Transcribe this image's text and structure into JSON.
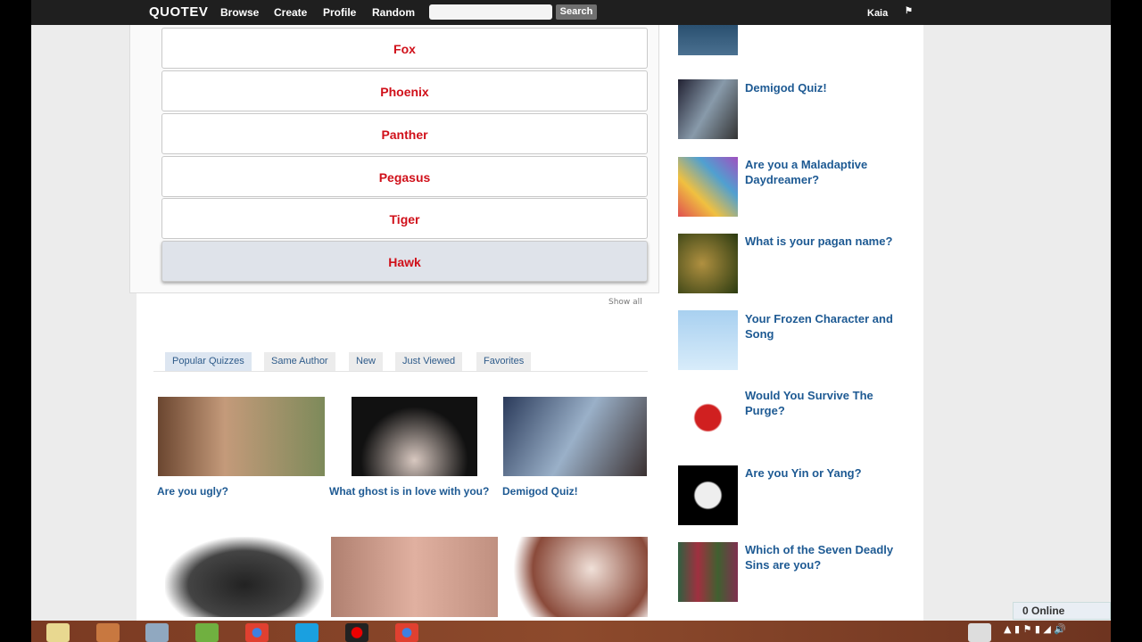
{
  "topbar": {
    "logo": "QUOTEV",
    "nav": [
      "Browse",
      "Create",
      "Profile",
      "Random"
    ],
    "search_placeholder": "",
    "search_button": "Search",
    "user": "Kaia"
  },
  "options": [
    {
      "label": "Fox",
      "selected": false
    },
    {
      "label": "Phoenix",
      "selected": false
    },
    {
      "label": "Panther",
      "selected": false
    },
    {
      "label": "Pegasus",
      "selected": false
    },
    {
      "label": "Tiger",
      "selected": false
    },
    {
      "label": "Hawk",
      "selected": true
    }
  ],
  "show_all": "Show all",
  "tabs": [
    "Popular Quizzes",
    "Same Author",
    "New",
    "Just Viewed",
    "Favorites"
  ],
  "active_tab": "Popular Quizzes",
  "quizzes": [
    "Are you ugly?",
    "What ghost is in love with you?",
    "Demigod Quiz!"
  ],
  "sidebar_quizzes": [
    "Demigod Quiz!",
    "Are you a Maladaptive Daydreamer?",
    "What is your pagan name?",
    "Your Frozen Character and Song",
    "Would You Survive The Purge?",
    "Are you Yin or Yang?",
    "Which of the Seven Deadly Sins are you?"
  ],
  "online": "0 Online",
  "colors": {
    "option_text": "#d0101a",
    "link": "#1e5a93",
    "topbar": "#1f1f1f"
  }
}
